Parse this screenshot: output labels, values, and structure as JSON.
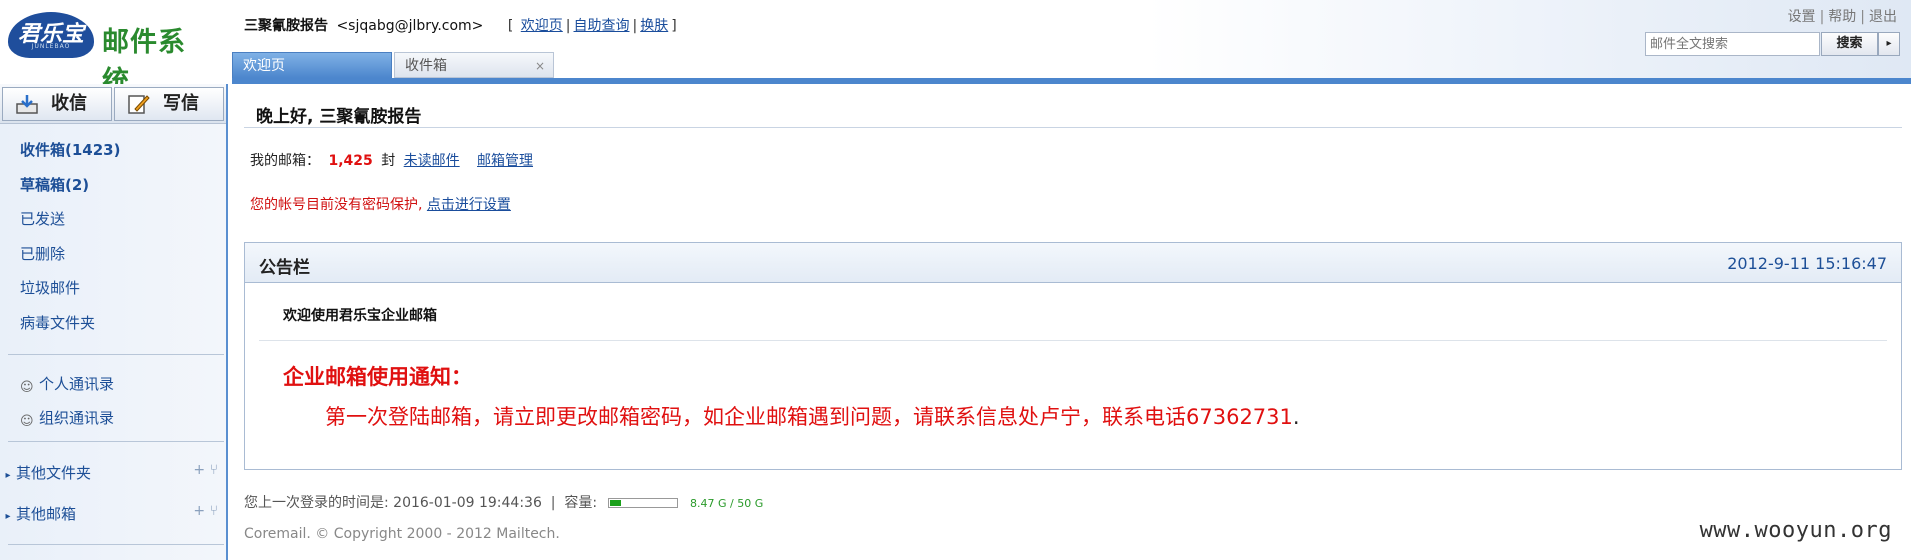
{
  "header": {
    "logo_badge": "君乐宝",
    "logo_badge_sub": "JUNLEBAO",
    "logo_title": "邮件系统",
    "user_name": "三聚氰胺报告",
    "user_email": "<sjqabg@jlbry.com>",
    "links": [
      "欢迎页",
      "自助查询",
      "换肤"
    ],
    "top_links": [
      "设置",
      "帮助",
      "退出"
    ],
    "search_placeholder": "邮件全文搜索",
    "search_button": "搜索",
    "tabs": [
      "欢迎页",
      "收件箱"
    ]
  },
  "sidebar": {
    "receive": "收信",
    "write": "写信",
    "folders": [
      "收件箱(1423)",
      "草稿箱(2)",
      "已发送",
      "已删除",
      "垃圾邮件",
      "病毒文件夹"
    ],
    "contacts": [
      "个人通讯录",
      "组织通讯录"
    ],
    "groups": [
      "其他文件夹",
      "其他邮箱"
    ]
  },
  "main": {
    "greeting": "晚上好, 三聚氰胺报告",
    "mailbox_label": "我的邮箱：",
    "mailbox_count": "1,425",
    "mailbox_unit": "封",
    "unread_link": "未读邮件",
    "manage_link": "邮箱管理",
    "warn_text": "您的帐号目前没有密码保护,",
    "warn_link": "点击进行设置",
    "notice": {
      "title": "公告栏",
      "date": "2012-9-11 15:16:47",
      "subtitle": "欢迎使用君乐宝企业邮箱",
      "heading": "企业邮箱使用通知：",
      "body": "第一次登陆邮箱，请立即更改邮箱密码，如企业邮箱遇到问题，请联系信息处卢宁，联系电话67362731",
      "body_end": "."
    },
    "last_login": "您上一次登录的时间是: 2016-01-09 19:44:36",
    "capacity_label": "容量:",
    "capacity_text": "8.47 G / 50 G",
    "capacity_fraction": 0.17,
    "copyright": "Coremail. © Copyright 2000 - 2012 Mailtech.",
    "watermark": "www.wooyun.org"
  }
}
